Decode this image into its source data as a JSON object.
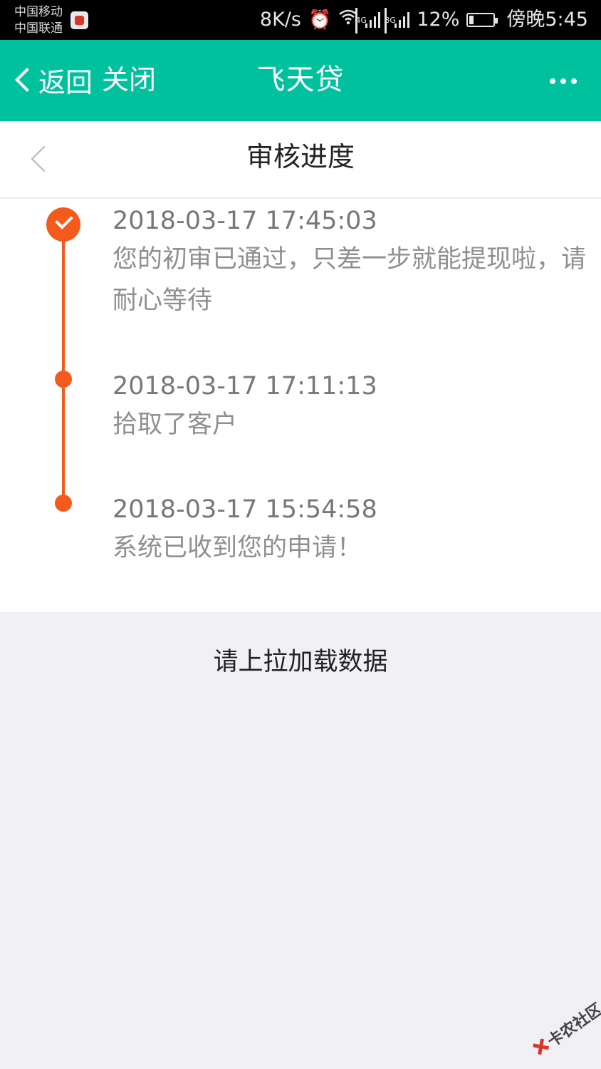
{
  "status_bar": {
    "carrier_1": "中国移动",
    "carrier_2": "中国联通",
    "speed": "8K/s",
    "sig1_tag": "4G",
    "sig2_tag": "3G",
    "battery": "12%",
    "time": "傍晚5:45"
  },
  "app_bar": {
    "back_label": "返回",
    "close_label": "关闭",
    "title": "飞天贷"
  },
  "page": {
    "title": "审核进度"
  },
  "timeline": [
    {
      "time": "2018-03-17 17:45:03",
      "text": "您的初审已通过，只差一步就能提现啦，请耐心等待",
      "status": "done"
    },
    {
      "time": "2018-03-17 17:11:13",
      "text": "拾取了客户",
      "status": "step"
    },
    {
      "time": "2018-03-17 15:54:58",
      "text": "系统已收到您的申请！",
      "status": "step"
    }
  ],
  "load_more": "请上拉加载数据",
  "watermark": "卡农社区",
  "colors": {
    "app_bar": "#00c19e",
    "timeline_accent": "#f45a1c",
    "background": "#f0f0f5"
  }
}
